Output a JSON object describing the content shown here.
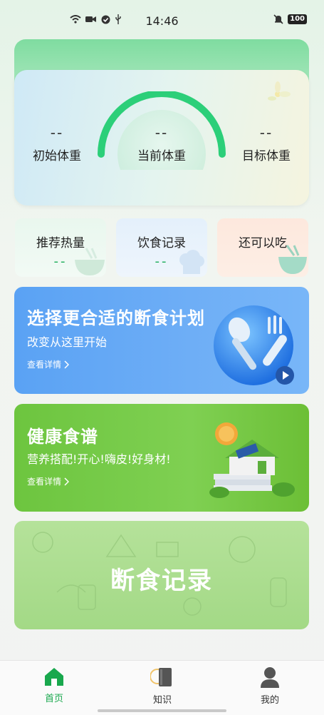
{
  "status_bar": {
    "time": "14:46",
    "battery": "100"
  },
  "weight": {
    "initial": {
      "value": "--",
      "label": "初始体重"
    },
    "current": {
      "value": "--",
      "label": "当前体重"
    },
    "target": {
      "value": "--",
      "label": "目标体重"
    }
  },
  "stats": [
    {
      "title": "推荐热量",
      "value": "--"
    },
    {
      "title": "饮食记录",
      "value": "--"
    },
    {
      "title": "还可以吃",
      "value": ""
    }
  ],
  "promos": {
    "fasting_plan": {
      "title": "选择更合适的断食计划",
      "subtitle": "改变从这里开始",
      "link": "查看详情"
    },
    "healthy_recipes": {
      "title": "健康食谱",
      "subtitle": "营养搭配!开心!嗨皮!好身材!",
      "link": "查看详情"
    },
    "fasting_record": {
      "title": "断食记录"
    }
  },
  "nav": [
    {
      "label": "首页",
      "active": true
    },
    {
      "label": "知识",
      "active": false
    },
    {
      "label": "我的",
      "active": false
    }
  ],
  "colors": {
    "accent": "#1eae5b",
    "blue_card": "#5ea6f5",
    "green_card": "#6cc13c",
    "record_card": "#a9dc8a"
  }
}
